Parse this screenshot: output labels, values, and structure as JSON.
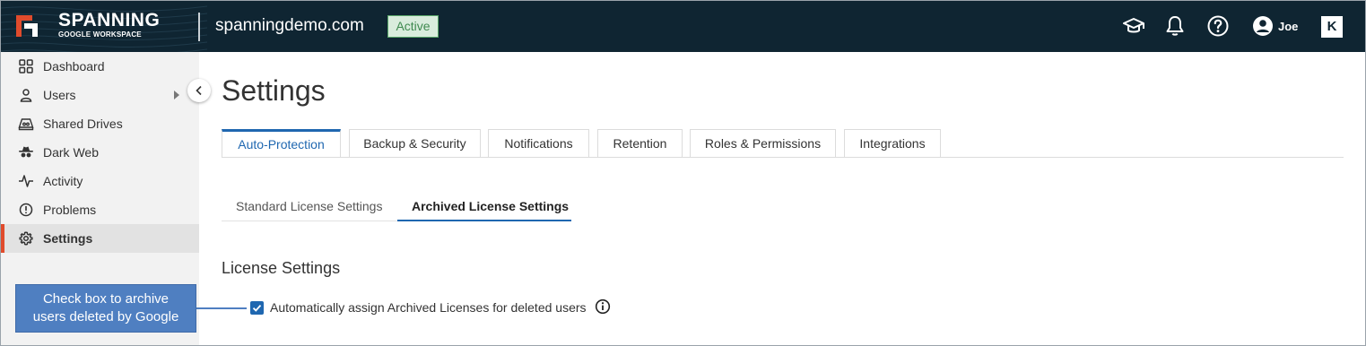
{
  "header": {
    "brand_name": "SPANNING",
    "brand_sub": "GOOGLE WORKSPACE",
    "domain": "spanningdemo.com",
    "status_badge": "Active",
    "user_name": "Joe",
    "k_label": "K",
    "icons": [
      "graduation-cap-icon",
      "bell-icon",
      "help-icon",
      "user-avatar-icon"
    ]
  },
  "sidebar": {
    "items": [
      {
        "label": "Dashboard",
        "icon": "dashboard-icon"
      },
      {
        "label": "Users",
        "icon": "user-icon"
      },
      {
        "label": "Shared Drives",
        "icon": "shared-drive-icon"
      },
      {
        "label": "Dark Web",
        "icon": "spy-icon"
      },
      {
        "label": "Activity",
        "icon": "activity-icon"
      },
      {
        "label": "Problems",
        "icon": "alert-icon"
      },
      {
        "label": "Settings",
        "icon": "gear-icon",
        "active": true
      }
    ]
  },
  "main": {
    "title": "Settings",
    "tabs": [
      {
        "label": "Auto-Protection",
        "active": true
      },
      {
        "label": "Backup & Security"
      },
      {
        "label": "Notifications"
      },
      {
        "label": "Retention"
      },
      {
        "label": "Roles & Permissions"
      },
      {
        "label": "Integrations"
      }
    ],
    "subtabs": [
      {
        "label": "Standard License Settings"
      },
      {
        "label": "Archived License Settings",
        "active": true
      }
    ],
    "section_title": "License Settings",
    "checkbox_label": "Automatically assign Archived Licenses for deleted users",
    "checkbox_checked": true
  },
  "callout": {
    "line1": "Check box to archive",
    "line2": "users deleted by Google"
  },
  "colors": {
    "topbar": "#0f2532",
    "accent": "#1f67b0",
    "active_indicator": "#e04b2c",
    "callout": "#4f7fc1"
  }
}
